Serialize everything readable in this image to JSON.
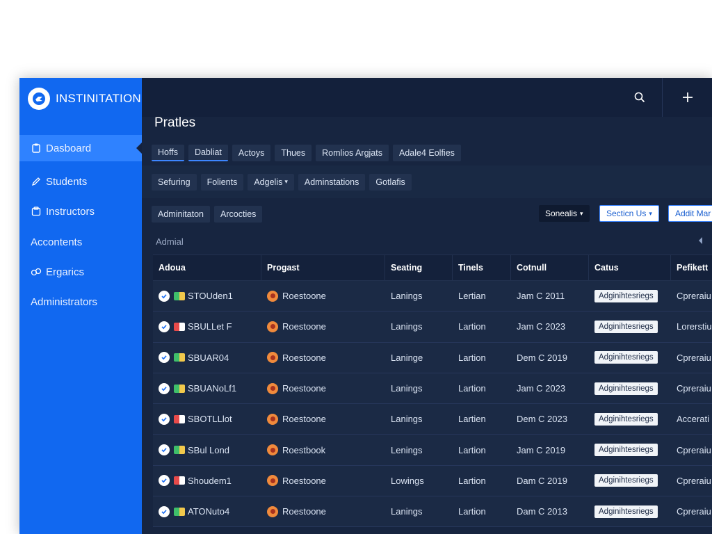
{
  "brand": {
    "name": "INSTINITATION"
  },
  "sidebar": {
    "items": [
      {
        "label": "Dasboard",
        "icon": "clipboard-icon",
        "active": true
      },
      {
        "label": "Students",
        "icon": "pencil-icon"
      },
      {
        "label": "Instructors",
        "icon": "folder-icon"
      },
      {
        "label": "Accontents",
        "icon": ""
      },
      {
        "label": "Ergarics",
        "icon": "link-icon"
      },
      {
        "label": "Administrators",
        "icon": ""
      }
    ]
  },
  "topbar": {
    "search_icon": "search-icon",
    "add_icon": "plus-icon"
  },
  "page": {
    "title": "Pratles"
  },
  "tabs_row1": [
    "Hoffs",
    "Dabliat",
    "Actoys",
    "Thues",
    "Romlios  Argjats",
    "Adale4 Eolfies"
  ],
  "tabs_row2": [
    "Sefuring",
    "Folients",
    "Adgelis",
    "Adminstations",
    "Gotlafis"
  ],
  "tabs_row3": [
    "Adminitaton",
    "Arcocties"
  ],
  "sort_buttons": {
    "dark": "Sonealis",
    "white": "Secticn Us",
    "white2": "Addit Mar"
  },
  "section": {
    "label": "Admial"
  },
  "table": {
    "headers": [
      "Adoua",
      "Progast",
      "Seating",
      "Tinels",
      "Cotnull",
      "Catus",
      "Pefikett"
    ],
    "rows": [
      {
        "name": "STOUden1",
        "flag": "green",
        "project": "Roestoone",
        "seating": "Lanings",
        "tinels": "Lertian",
        "cotnull": "Jam C 2011",
        "status": "Adginihtesriegs",
        "extra": "Cpreraiu"
      },
      {
        "name": "SBULLet F",
        "flag": "red",
        "project": "Roestoone",
        "seating": "Lanings",
        "tinels": "Lartion",
        "cotnull": "Jam C 2023",
        "status": "Adginihtesriegs",
        "extra": "Lorerstiu"
      },
      {
        "name": "SBUAR04",
        "flag": "green",
        "project": "Roestoone",
        "seating": "Laninge",
        "tinels": "Lartion",
        "cotnull": "Dem C 2019",
        "status": "Adginihtesriegs",
        "extra": "Cpreraiu"
      },
      {
        "name": "SBUANoLf1",
        "flag": "green",
        "project": "Roestoone",
        "seating": "Lanings",
        "tinels": "Lartion",
        "cotnull": "Jam C 2023",
        "status": "Adginihtesriegs",
        "extra": "Cpreraiu"
      },
      {
        "name": "SBOTLLlot",
        "flag": "red",
        "project": "Roestoone",
        "seating": "Lanings",
        "tinels": "Lartien",
        "cotnull": "Dem C 2023",
        "status": "Adginihtesriegs",
        "extra": "Accerati"
      },
      {
        "name": "SBul Lond",
        "flag": "green",
        "project": "Roestbook",
        "seating": "Lenings",
        "tinels": "Lartion",
        "cotnull": "Jam C 2019",
        "status": "Adginihtesriegs",
        "extra": "Cpreraiu"
      },
      {
        "name": "Shoudem1",
        "flag": "red",
        "project": "Roestoone",
        "seating": "Lowings",
        "tinels": "Lartion",
        "cotnull": "Dam C 2019",
        "status": "Adginihtesriegs",
        "extra": "Cpreraiu"
      },
      {
        "name": "ATONuto4",
        "flag": "green",
        "project": "Roestoone",
        "seating": "Lanings",
        "tinels": "Lartion",
        "cotnull": "Dam C 2013",
        "status": "Adginihtesriegs",
        "extra": "Cpreraiu"
      }
    ]
  },
  "colors": {
    "sidebar": "#1168f0",
    "sidebar_active": "#2f82ff",
    "background": "#172540",
    "accent": "#3d86ff"
  }
}
